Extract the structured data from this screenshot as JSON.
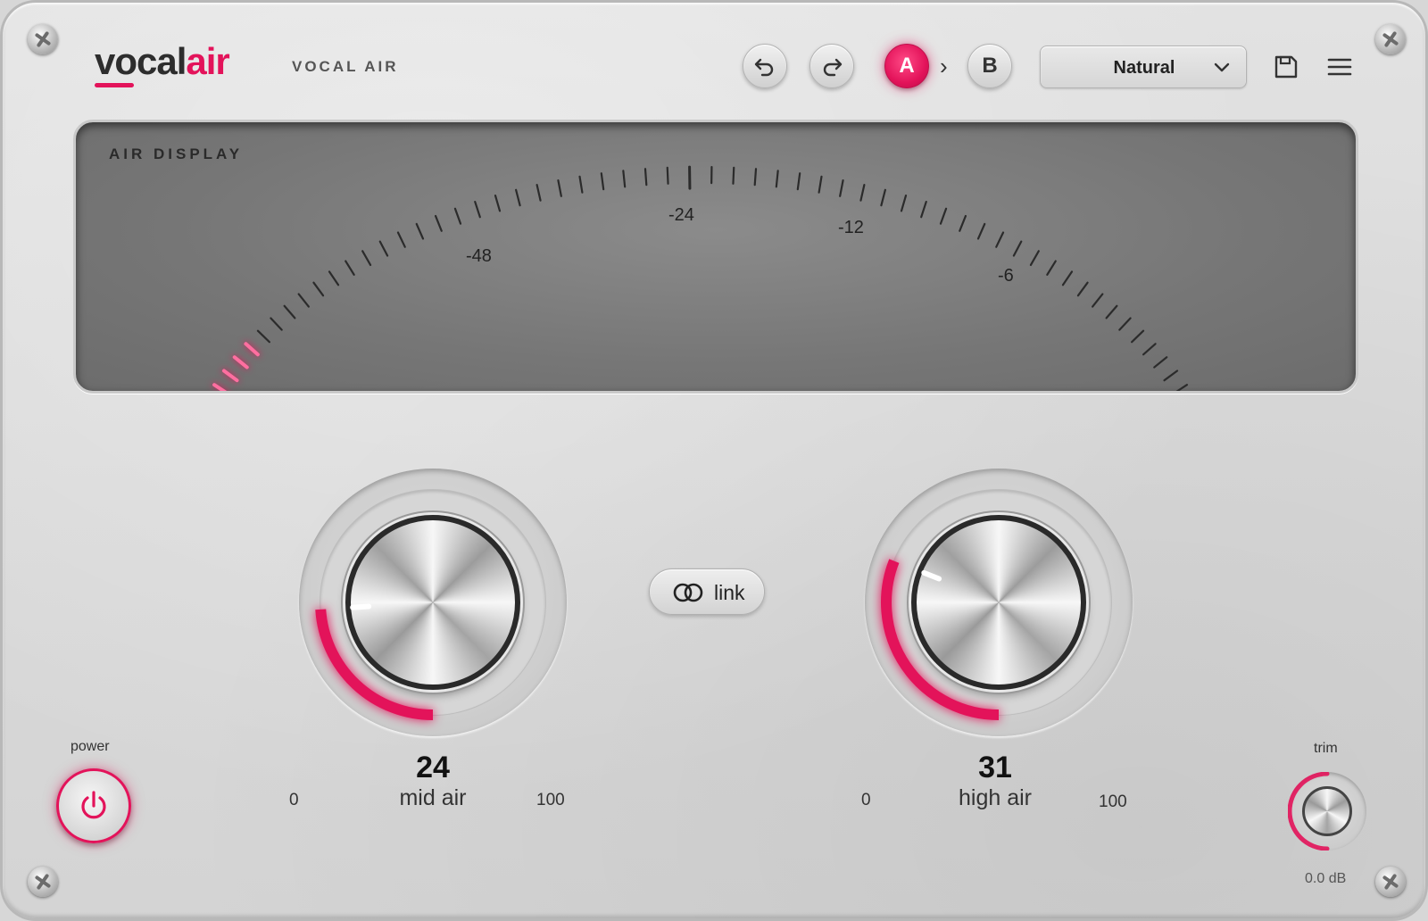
{
  "header": {
    "logo_main": "vocal",
    "logo_accent": "air",
    "subtitle": "VOCAL AIR",
    "undo_icon": "undo-icon",
    "redo_icon": "redo-icon",
    "ab_a_label": "A",
    "ab_arrow": "›",
    "ab_b_label": "B",
    "preset_selected": "Natural",
    "save_icon": "save-icon",
    "menu_icon": "menu-icon"
  },
  "display": {
    "title": "AIR DISPLAY",
    "scale_labels": [
      "-48",
      "-24",
      "-12",
      "-6"
    ],
    "active_ticks": 6
  },
  "knobs": {
    "mid": {
      "value": "24",
      "name": "mid air",
      "min": "0",
      "max": "100",
      "fraction": 0.24
    },
    "high": {
      "value": "31",
      "name": "high air",
      "min": "0",
      "max": "100",
      "fraction": 0.31
    }
  },
  "link": {
    "label": "link"
  },
  "power": {
    "label": "power"
  },
  "trim": {
    "label": "trim",
    "value": "0.0 dB"
  },
  "colors": {
    "accent": "#e3135a",
    "display": "#767676",
    "panel": "#d9d9d9"
  }
}
